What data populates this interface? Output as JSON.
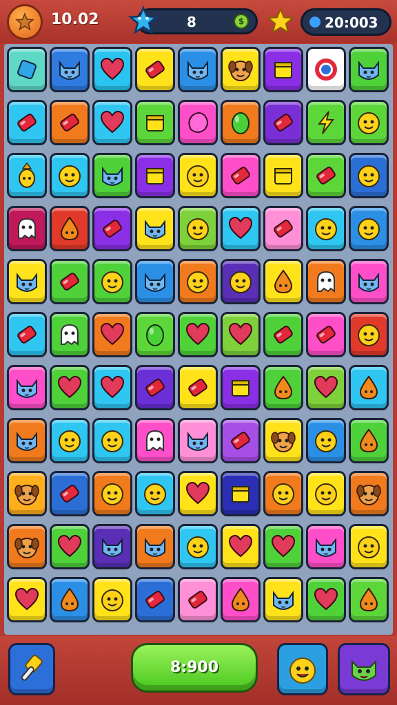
{
  "hud": {
    "level": "10.02",
    "moves": "8",
    "score": "20:003",
    "avatar_icon": "star-icon",
    "coin_symbol": "$"
  },
  "bottom": {
    "play_value": "8:900",
    "hammer_icon": "hammer-icon",
    "booster1_icon": "face-icon",
    "booster2_icon": "cat-face-icon"
  },
  "board": {
    "rows": [
      [
        [
          "#5fd9c6",
          "square"
        ],
        [
          "#2f7be0",
          "cat"
        ],
        [
          "#29c4f0",
          "heart"
        ],
        [
          "#ffe21a",
          "candy"
        ],
        [
          "#2b8fe6",
          "cat"
        ],
        [
          "#ffe21a",
          "dog"
        ],
        [
          "#8a2fe6",
          "box"
        ],
        [
          "#ffffff",
          "ring"
        ],
        [
          "#4fd13a",
          "cat"
        ]
      ],
      [
        [
          "#2fc6f2",
          "candy"
        ],
        [
          "#f07a1c",
          "candy"
        ],
        [
          "#2fc6f2",
          "heart"
        ],
        [
          "#5dd63a",
          "box"
        ],
        [
          "#ff4fc8",
          "blob"
        ],
        [
          "#f07a1c",
          "egg"
        ],
        [
          "#7a2fd6",
          "candy"
        ],
        [
          "#5dd63a",
          "bolt"
        ],
        [
          "#5dd63a",
          "face"
        ]
      ],
      [
        [
          "#2fc6f2",
          "pine"
        ],
        [
          "#2fc6f2",
          "face"
        ],
        [
          "#4fd13a",
          "cat"
        ],
        [
          "#8a2fe6",
          "box"
        ],
        [
          "#ffe21a",
          "face"
        ],
        [
          "#ff4fc8",
          "candy"
        ],
        [
          "#ffe21a",
          "box"
        ],
        [
          "#5dd63a",
          "candy"
        ],
        [
          "#2b6fd6",
          "face"
        ]
      ],
      [
        [
          "#c0185a",
          "ghost"
        ],
        [
          "#e23a2a",
          "drop"
        ],
        [
          "#8a2fe6",
          "candy"
        ],
        [
          "#ffe21a",
          "cat"
        ],
        [
          "#7ed13a",
          "face"
        ],
        [
          "#2fc6f2",
          "heart"
        ],
        [
          "#ff8fd6",
          "candy"
        ],
        [
          "#2fc6f2",
          "face"
        ],
        [
          "#2b8fe6",
          "face"
        ]
      ],
      [
        [
          "#ffe21a",
          "cat"
        ],
        [
          "#4fd13a",
          "candy"
        ],
        [
          "#4fd13a",
          "face"
        ],
        [
          "#2b8fe6",
          "cat"
        ],
        [
          "#f07a1c",
          "face"
        ],
        [
          "#5a2fb6",
          "face"
        ],
        [
          "#ffe21a",
          "drop"
        ],
        [
          "#f07a1c",
          "ghost"
        ],
        [
          "#ff4fc8",
          "cat"
        ]
      ],
      [
        [
          "#2fc6f2",
          "candy"
        ],
        [
          "#4fd13a",
          "ghost"
        ],
        [
          "#f07a1c",
          "heart"
        ],
        [
          "#5dd63a",
          "egg"
        ],
        [
          "#4fd13a",
          "heart"
        ],
        [
          "#7ed13a",
          "heart"
        ],
        [
          "#4fd13a",
          "candy"
        ],
        [
          "#ff4fc8",
          "candy"
        ],
        [
          "#e23a2a",
          "face"
        ]
      ],
      [
        [
          "#ff4fc8",
          "cat"
        ],
        [
          "#4fd13a",
          "heart"
        ],
        [
          "#2fc6f2",
          "heart"
        ],
        [
          "#6a2fd6",
          "candy"
        ],
        [
          "#ffe21a",
          "candy"
        ],
        [
          "#8a2fe6",
          "box"
        ],
        [
          "#4fd13a",
          "drop"
        ],
        [
          "#7ed13a",
          "heart"
        ],
        [
          "#2fc6f2",
          "drop"
        ]
      ],
      [
        [
          "#f07a1c",
          "cat"
        ],
        [
          "#2fc6f2",
          "face"
        ],
        [
          "#2fc6f2",
          "face"
        ],
        [
          "#ff4fc8",
          "ghost"
        ],
        [
          "#ff8fd6",
          "cat"
        ],
        [
          "#a64fe6",
          "candy"
        ],
        [
          "#ffe21a",
          "dog"
        ],
        [
          "#2b8fe6",
          "face"
        ],
        [
          "#4fd13a",
          "drop"
        ]
      ],
      [
        [
          "#ffae1c",
          "dog"
        ],
        [
          "#2b6fd6",
          "candy"
        ],
        [
          "#f07a1c",
          "face"
        ],
        [
          "#2fc6f2",
          "face"
        ],
        [
          "#ffe21a",
          "heart"
        ],
        [
          "#2b2fb6",
          "box"
        ],
        [
          "#f07a1c",
          "face"
        ],
        [
          "#ffe21a",
          "face"
        ],
        [
          "#f07a1c",
          "dog"
        ]
      ],
      [
        [
          "#f07a1c",
          "dog"
        ],
        [
          "#4fd13a",
          "heart"
        ],
        [
          "#5a2fb6",
          "cat"
        ],
        [
          "#f07a1c",
          "cat"
        ],
        [
          "#2fc6f2",
          "face"
        ],
        [
          "#ffe21a",
          "heart"
        ],
        [
          "#4fd13a",
          "heart"
        ],
        [
          "#ff4fc8",
          "cat"
        ],
        [
          "#ffe21a",
          "face"
        ]
      ],
      [
        [
          "#ffe21a",
          "heart"
        ],
        [
          "#2b8fe6",
          "drop"
        ],
        [
          "#ffe21a",
          "face"
        ],
        [
          "#2b6fd6",
          "candy"
        ],
        [
          "#ff8fd6",
          "candy"
        ],
        [
          "#ff4fc8",
          "drop"
        ],
        [
          "#ffe21a",
          "cat"
        ],
        [
          "#4fd13a",
          "heart"
        ],
        [
          "#5dd63a",
          "drop"
        ]
      ]
    ]
  }
}
